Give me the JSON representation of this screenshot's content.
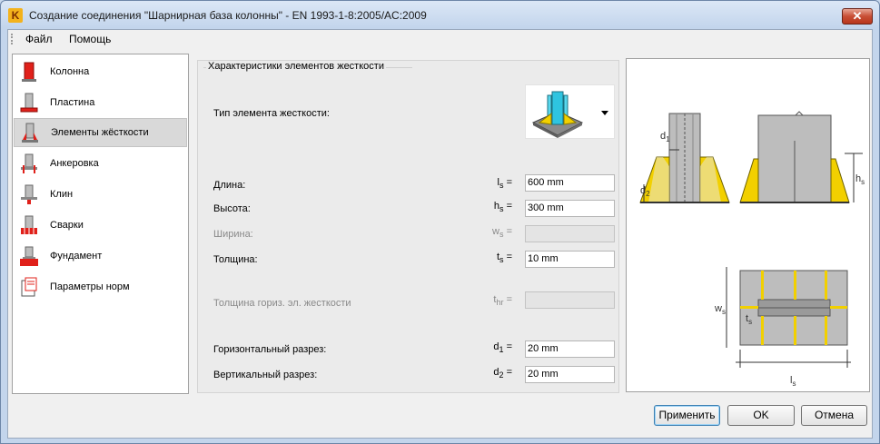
{
  "window": {
    "title": "Создание соединения \"Шарнирная база колонны\" - EN 1993-1-8:2005/AC:2009",
    "close_glyph": "✕",
    "app_icon_letter": "K"
  },
  "menu": {
    "items": [
      {
        "label": "Файл"
      },
      {
        "label": "Помощь"
      }
    ]
  },
  "sidebar": {
    "items": [
      {
        "label": "Колонна",
        "icon": "column-icon"
      },
      {
        "label": "Пластина",
        "icon": "plate-icon"
      },
      {
        "label": "Элементы жёсткости",
        "icon": "stiffeners-icon",
        "selected": true
      },
      {
        "label": "Анкеровка",
        "icon": "anchorage-icon"
      },
      {
        "label": "Клин",
        "icon": "wedge-icon"
      },
      {
        "label": "Сварки",
        "icon": "welds-icon"
      },
      {
        "label": "Фундамент",
        "icon": "foundation-icon"
      },
      {
        "label": "Параметры норм",
        "icon": "code-parameters-icon"
      }
    ]
  },
  "stiffeners": {
    "group_title": "Характеристики элементов жесткости",
    "type_label": "Тип элемента жесткости:",
    "length": {
      "label": "Длина:",
      "symbol": "l",
      "sub": "s",
      "value": "600 mm"
    },
    "height": {
      "label": "Высота:",
      "symbol": "h",
      "sub": "s",
      "value": "300 mm"
    },
    "width": {
      "label": "Ширина:",
      "symbol": "w",
      "sub": "s",
      "value": ""
    },
    "thickness": {
      "label": "Толщина:",
      "symbol": "t",
      "sub": "s",
      "value": "10 mm"
    },
    "horiz_thickness": {
      "label": "Толщина гориз. эл. жесткости",
      "symbol": "t",
      "sub": "hr",
      "value": ""
    },
    "horiz_cut": {
      "label": "Горизонтальный разрез:",
      "symbol": "d",
      "sub": "1",
      "value": "20 mm"
    },
    "vert_cut": {
      "label": "Вертикальный разрез:",
      "symbol": "d",
      "sub": "2",
      "value": "20 mm"
    },
    "equals": "="
  },
  "preview": {
    "labels": {
      "d1": "d",
      "d1_sub": "1",
      "d2": "d",
      "d2_sub": "2",
      "hs": "h",
      "hs_sub": "s",
      "ws": "w",
      "ws_sub": "s",
      "ts": "t",
      "ts_sub": "s",
      "ls": "l",
      "ls_sub": "s"
    }
  },
  "buttons": {
    "apply": "Применить",
    "ok": "OK",
    "cancel": "Отмена"
  },
  "colors": {
    "stiffener_yellow": "#f2d000",
    "icon_red": "#e0201a",
    "steel_grey": "#bdbdbd"
  }
}
